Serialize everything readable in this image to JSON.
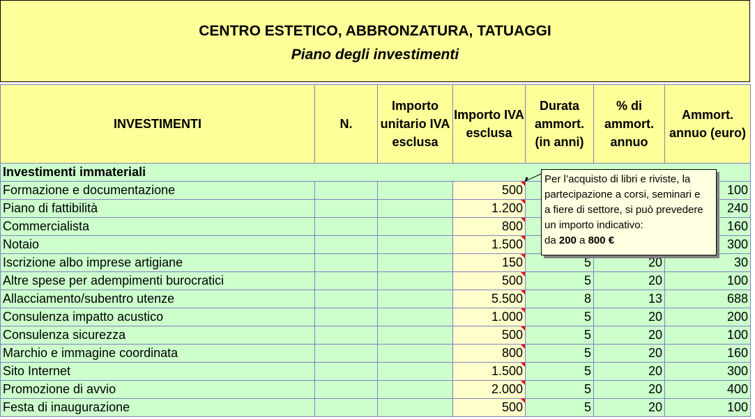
{
  "title": {
    "main": "CENTRO ESTETICO, ABBRONZATURA, TATUAGGI",
    "sub": "Piano degli investimenti"
  },
  "headers": {
    "investimenti": "INVESTIMENTI",
    "n": "N.",
    "unitario": "Importo unitario IVA esclusa",
    "importo": "Importo IVA esclusa",
    "durata": "Durata ammort. (in anni)",
    "perc": "% di ammort. annuo",
    "ammort": "Ammort. annuo (euro)"
  },
  "section": "Investimenti immateriali",
  "rows": [
    {
      "label": "Formazione e documentazione",
      "importo": "500",
      "durata": "",
      "perc": "",
      "ammort": "100"
    },
    {
      "label": "Piano di fattibilità",
      "importo": "1.200",
      "durata": "",
      "perc": "",
      "ammort": "240"
    },
    {
      "label": "Commercialista",
      "importo": "800",
      "durata": "",
      "perc": "",
      "ammort": "160"
    },
    {
      "label": "Notaio",
      "importo": "1.500",
      "durata": "",
      "perc": "",
      "ammort": "300"
    },
    {
      "label": "Iscrizione albo imprese artigiane",
      "importo": "150",
      "durata": "5",
      "perc": "20",
      "ammort": "30"
    },
    {
      "label": "Altre spese per adempimenti burocratici",
      "importo": "500",
      "durata": "5",
      "perc": "20",
      "ammort": "100"
    },
    {
      "label": "Allacciamento/subentro utenze",
      "importo": "5.500",
      "durata": "8",
      "perc": "13",
      "ammort": "688"
    },
    {
      "label": "Consulenza impatto acustico",
      "importo": "1.000",
      "durata": "5",
      "perc": "20",
      "ammort": "200"
    },
    {
      "label": "Consulenza sicurezza",
      "importo": "500",
      "durata": "5",
      "perc": "20",
      "ammort": "100"
    },
    {
      "label": "Marchio e immagine coordinata",
      "importo": "800",
      "durata": "5",
      "perc": "20",
      "ammort": "160"
    },
    {
      "label": "Sito Internet",
      "importo": "1.500",
      "durata": "5",
      "perc": "20",
      "ammort": "300"
    },
    {
      "label": "Promozione di avvio",
      "importo": "2.000",
      "durata": "5",
      "perc": "20",
      "ammort": "400"
    },
    {
      "label": "Festa di inaugurazione",
      "importo": "500",
      "durata": "5",
      "perc": "20",
      "ammort": "100"
    }
  ],
  "tooltip": {
    "line1": "Per l’acquisto di libri e riviste, la",
    "line2": "partecipazione a corsi, seminari e",
    "line3": "a fiere di settore, si può prevedere",
    "line4": "un importo indicativo:",
    "range_prefix": "da",
    "range_min": "200",
    "range_mid": "a",
    "range_max": "800 €"
  }
}
